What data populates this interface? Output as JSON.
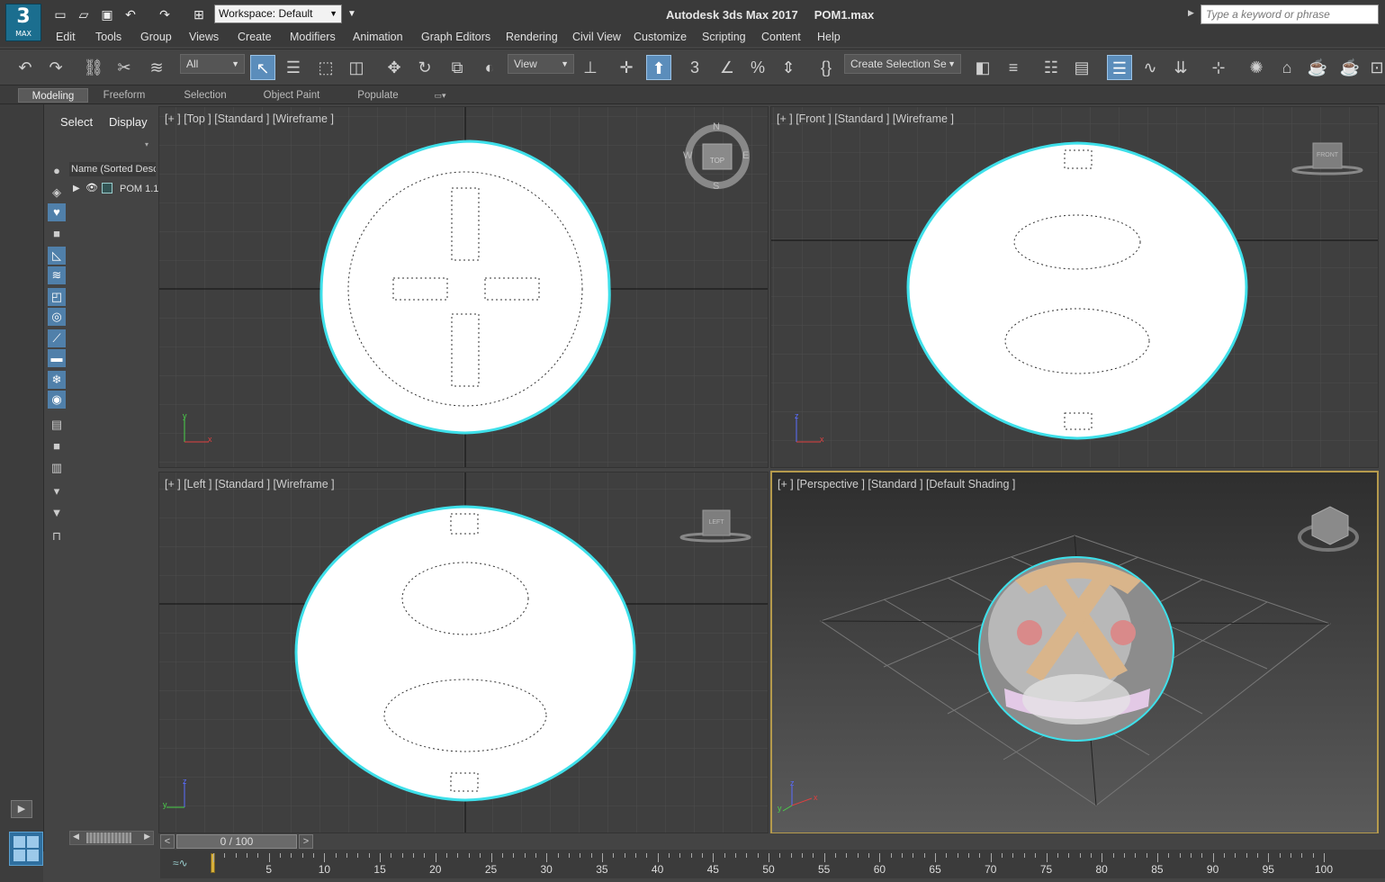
{
  "app": {
    "logo_number": "3",
    "logo_text": "MAX",
    "title": "Autodesk 3ds Max 2017     POM1.max",
    "workspace": "Workspace: Default",
    "search_placeholder": "Type a keyword or phrase"
  },
  "menu": [
    "Edit",
    "Tools",
    "Group",
    "Views",
    "Create",
    "Modifiers",
    "Animation",
    "Graph Editors",
    "Rendering",
    "Civil View",
    "Customize",
    "Scripting",
    "Content",
    "Help"
  ],
  "toolbar": {
    "filter": "All",
    "ref_coord": "View",
    "selection_set": "Create Selection Se"
  },
  "ribbon_tabs": [
    "Modeling",
    "Freeform",
    "Selection",
    "Object Paint",
    "Populate"
  ],
  "explorer": {
    "tabs": [
      "Select",
      "Display"
    ],
    "column_header": "Name (Sorted Desc",
    "object": "POM 1.1"
  },
  "viewports": {
    "top": "[+ ] [Top ] [Standard ] [Wireframe ]",
    "front": "[+ ] [Front ] [Standard ] [Wireframe ]",
    "left": "[+ ] [Left ] [Standard ] [Wireframe ]",
    "perspective": "[+ ] [Perspective ] [Standard ] [Default Shading ]",
    "cube_top": "TOP",
    "cube_front": "FRONT",
    "cube_left": "LEFT",
    "compass": [
      "N",
      "S",
      "W",
      "E"
    ],
    "axes": [
      "x",
      "y",
      "z"
    ]
  },
  "timeline": {
    "position": "0 / 100",
    "ticks": [
      "5",
      "10",
      "15",
      "20",
      "25",
      "30",
      "35",
      "40",
      "45",
      "50",
      "55",
      "60",
      "65",
      "70",
      "75",
      "80",
      "85",
      "90",
      "95",
      "100"
    ]
  }
}
